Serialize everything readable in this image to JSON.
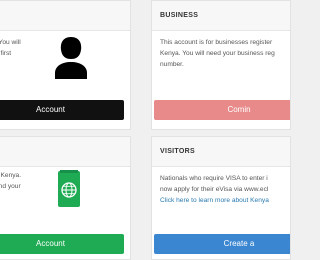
{
  "cards": {
    "personal": {
      "desc_lines": [
        ". You will",
        "ir first"
      ],
      "button_label": "Account",
      "icon": "person-silhouette-icon",
      "button_color": "#111111"
    },
    "business": {
      "title": "BUSINESS",
      "desc_lines": [
        "This account is for businesses register",
        "Kenya. You will need your business reg",
        "number."
      ],
      "button_label": "Comin",
      "button_color": "#e88a8a"
    },
    "resident": {
      "desc_lines": [
        "n Kenya.",
        "and your"
      ],
      "button_label": "Account",
      "icon": "passport-icon",
      "button_color": "#1fab54"
    },
    "visitors": {
      "title": "VISITORS",
      "desc_lines": [
        "Nationals who require VISA to enter i",
        "now apply for their eVisa via www.ecl"
      ],
      "link_text": "Click here to learn more about Kenya",
      "button_label": "Create a",
      "button_color": "#3a86d0"
    }
  }
}
